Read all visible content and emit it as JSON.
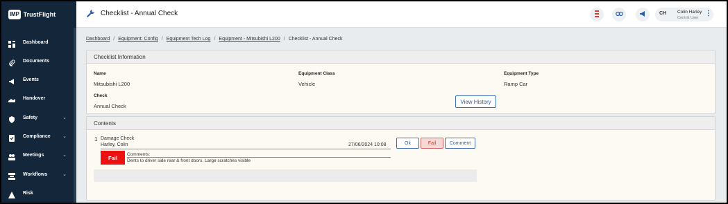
{
  "brand": {
    "logo_text": "IMP",
    "name": "TrustFlight"
  },
  "sidebar": {
    "items": [
      {
        "label": "Dashboard",
        "icon": "dashboard-icon",
        "chevron": ""
      },
      {
        "label": "Documents",
        "icon": "paperclip-icon",
        "chevron": ""
      },
      {
        "label": "Events",
        "icon": "megaphone-icon",
        "chevron": ""
      },
      {
        "label": "Handover",
        "icon": "handover-icon",
        "chevron": ""
      },
      {
        "label": "Safety",
        "icon": "shield-icon",
        "chevron": "⌄"
      },
      {
        "label": "Compliance",
        "icon": "compliance-icon",
        "chevron": "⌄"
      },
      {
        "label": "Meetings",
        "icon": "meetings-icon",
        "chevron": "⌄"
      },
      {
        "label": "Workflows",
        "icon": "workflows-icon",
        "chevron": "⌄"
      },
      {
        "label": "Risk",
        "icon": "warning-icon",
        "chevron": ""
      }
    ]
  },
  "header": {
    "title": "Checklist - Annual Check",
    "user": {
      "initials": "CH",
      "name": "Colin Harley",
      "role": "Centrik User"
    }
  },
  "breadcrumbs": {
    "items": [
      "Dashboard",
      "Equipment: Config",
      "Equipment Tech Log",
      "Equipment - Mitsubishi L200"
    ],
    "current": "Checklist - Annual Check",
    "separator": "/"
  },
  "info": {
    "heading": "Checklist Information",
    "name_label": "Name",
    "name_value": "Mitsubishi L200",
    "class_label": "Equipment Class",
    "class_value": "Vehicle",
    "type_label": "Equipment Type",
    "type_value": "Ramp Car",
    "check_label": "Check",
    "check_value": "Annual Check",
    "history_button": "View History"
  },
  "contents": {
    "heading": "Contents",
    "items": [
      {
        "number": "1",
        "title": "Damage Check",
        "user": "Harley, Colin",
        "date": "27/06/2024 10:08",
        "status": "Fail",
        "comments_label": "Comments:",
        "comment": "Dents to driver side rear & front doors. Large scratches visible",
        "ok_label": "Ok",
        "fail_label": "Fail",
        "comment_button": "Comment"
      }
    ]
  },
  "colors": {
    "sidebar_bg": "#13263a",
    "accent": "#2b5ea7",
    "fail": "#ee1111",
    "fail_selected_bg": "#f6d9d6"
  }
}
